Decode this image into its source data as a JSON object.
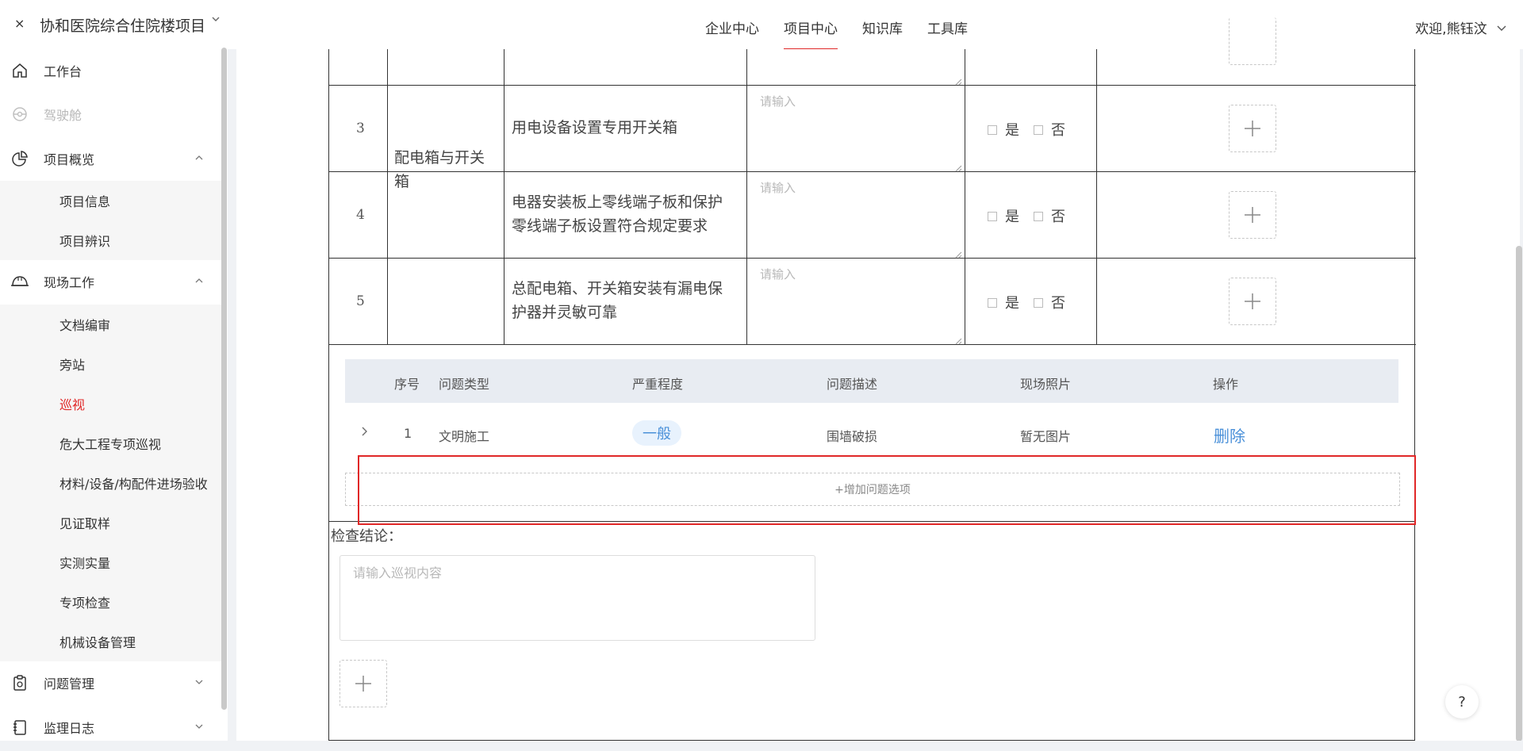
{
  "header": {
    "close": "×",
    "project": "协和医院综合住院楼项目",
    "nav": [
      "企业中心",
      "项目中心",
      "知识库",
      "工具库"
    ],
    "welcome": "欢迎,熊钰汶"
  },
  "sidebar": {
    "workbench": "工作台",
    "cockpit": "驾驶舱",
    "overview": "项目概览",
    "overview_sub": [
      "项目信息",
      "项目辨识"
    ],
    "fieldwork": "现场工作",
    "fieldwork_sub": [
      "文档编审",
      "旁站",
      "巡视",
      "危大工程专项巡视",
      "材料/设备/构配件进场验收",
      "见证取样",
      "实测实量",
      "专项检查",
      "机械设备管理"
    ],
    "issues": "问题管理",
    "log": "监理日志"
  },
  "checklist": {
    "category": [
      "配电箱与开关",
      "箱"
    ],
    "rows": [
      {
        "no": "3",
        "lines": [
          "用电设备设置专用开关箱"
        ]
      },
      {
        "no": "4",
        "lines": [
          "电器安装板上零线端子板和保护",
          "零线端子板设置符合规定要求"
        ]
      },
      {
        "no": "5",
        "lines": [
          "总配电箱、开关箱安装有漏电保",
          "护器并灵敏可靠"
        ]
      }
    ],
    "placeholder": "请输入",
    "yes": "是",
    "no": "否"
  },
  "problems": {
    "headers": [
      "序号",
      "问题类型",
      "严重程度",
      "问题描述",
      "现场照片",
      "操作"
    ],
    "rows": [
      {
        "no": "1",
        "type": "文明施工",
        "severity": "一般",
        "desc": "围墙破损",
        "photo": "暂无图片",
        "action": "删除"
      }
    ],
    "add_label": "+增加问题选项"
  },
  "conclusion": {
    "label": "检查结论：",
    "placeholder": "请输入巡视内容"
  },
  "help": "?"
}
